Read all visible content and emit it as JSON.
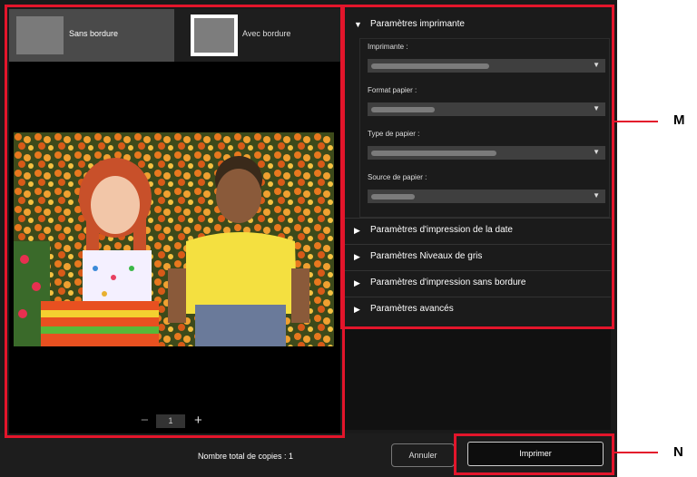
{
  "tabs": [
    {
      "label": "Sans bordure"
    },
    {
      "label": "Avec bordure"
    }
  ],
  "stepper": {
    "minus": "−",
    "value": "1",
    "plus": "+"
  },
  "printer_settings": {
    "title": "Paramètres imprimante",
    "printer_label": "Imprimante :",
    "paper_size_label": "Format papier :",
    "media_type_label": "Type de papier :",
    "paper_source_label": "Source de papier :"
  },
  "collapsed_sections": [
    {
      "label": "Paramètres d'impression de la date"
    },
    {
      "label": "Paramètres Niveaux de gris"
    },
    {
      "label": "Paramètres d'impression sans bordure"
    },
    {
      "label": "Paramètres avancés"
    }
  ],
  "footer": {
    "total_copies": "Nombre total de copies : 1",
    "cancel_label": "Annuler",
    "print_label": "Imprimer"
  },
  "callouts": {
    "m": "M",
    "n": "N"
  },
  "colors": {
    "highlight": "#e3152b"
  },
  "icons": {
    "expanded": "triangle-down-icon",
    "collapsed": "triangle-right-icon",
    "dropdown": "dropdown-arrow-icon"
  }
}
